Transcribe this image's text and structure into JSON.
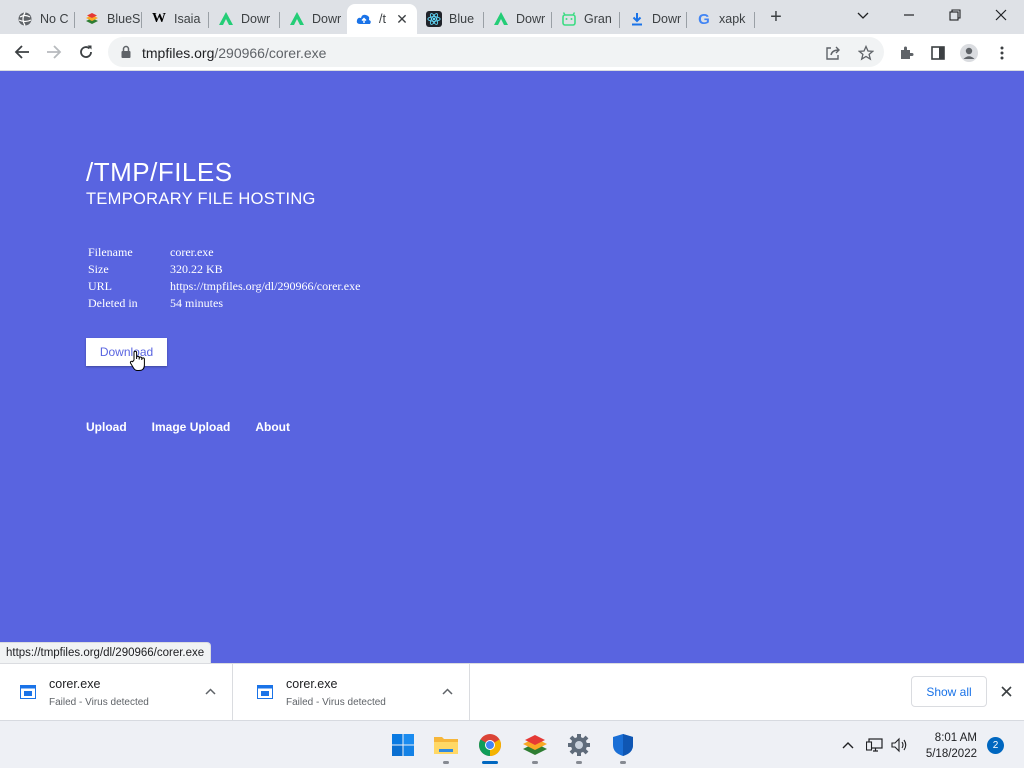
{
  "browser": {
    "tabs": [
      {
        "label": "No C",
        "icon": "globe-icon"
      },
      {
        "label": "BlueS",
        "icon": "bluestacks-icon"
      },
      {
        "label": "Isaia",
        "icon": "wikipedia-icon"
      },
      {
        "label": "Dowr",
        "icon": "apkpure-icon"
      },
      {
        "label": "Dowr",
        "icon": "apkpure-icon"
      },
      {
        "label": "/t",
        "icon": "cloud-upload-icon",
        "active": true
      },
      {
        "label": "Blue",
        "icon": "react-icon"
      },
      {
        "label": "Dowr",
        "icon": "apkpure-icon"
      },
      {
        "label": "Gran",
        "icon": "android-icon"
      },
      {
        "label": "Dowr",
        "icon": "download-icon"
      },
      {
        "label": "xapk",
        "icon": "google-icon"
      }
    ],
    "new_tab": "+",
    "url_host": "tmpfiles.org",
    "url_path": "/290966/corer.exe",
    "status_url": "https://tmpfiles.org/dl/290966/corer.exe"
  },
  "page": {
    "title": "/TMP/FILES",
    "subtitle": "TEMPORARY FILE HOSTING",
    "info": [
      {
        "key": "Filename",
        "value": "corer.exe"
      },
      {
        "key": "Size",
        "value": "320.22 KB"
      },
      {
        "key": "URL",
        "value": "https://tmpfiles.org/dl/290966/corer.exe"
      },
      {
        "key": "Deleted in",
        "value": "54 minutes"
      }
    ],
    "download_label": "Download",
    "nav": [
      "Upload",
      "Image Upload",
      "About"
    ],
    "background_color": "#5964e0"
  },
  "downloads": {
    "items": [
      {
        "name": "corer.exe",
        "status": "Failed - Virus detected"
      },
      {
        "name": "corer.exe",
        "status": "Failed - Virus detected"
      }
    ],
    "show_all": "Show all"
  },
  "taskbar": {
    "apps": [
      "windows-start-icon",
      "file-explorer-icon",
      "chrome-icon",
      "bluestacks-icon",
      "settings-icon",
      "defender-icon"
    ],
    "time": "8:01 AM",
    "date": "5/18/2022",
    "notification_count": "2"
  }
}
